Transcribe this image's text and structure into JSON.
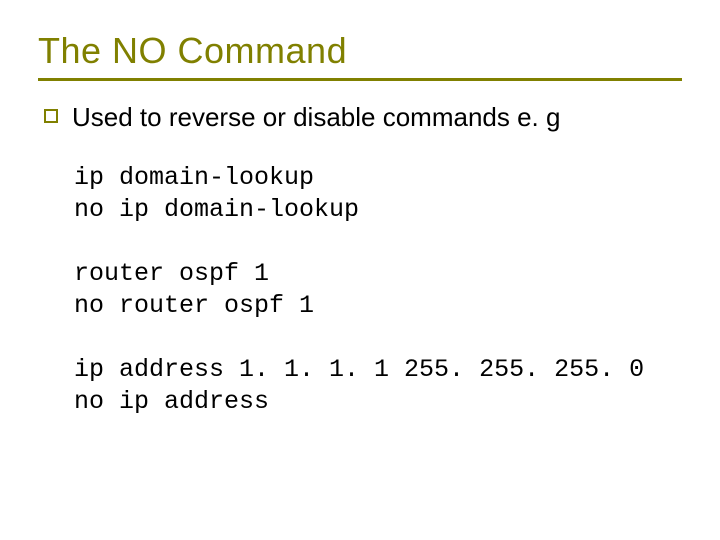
{
  "title": "The NO Command",
  "bullet": "Used to reverse or disable commands e. g",
  "code1_line1": "ip domain-lookup",
  "code1_line2": "no ip domain-lookup",
  "code2_line1": "router ospf 1",
  "code2_line2": "no router ospf 1",
  "code3_line1": "ip address 1. 1. 1. 1 255. 255. 255. 0",
  "code3_line2": "no ip address"
}
